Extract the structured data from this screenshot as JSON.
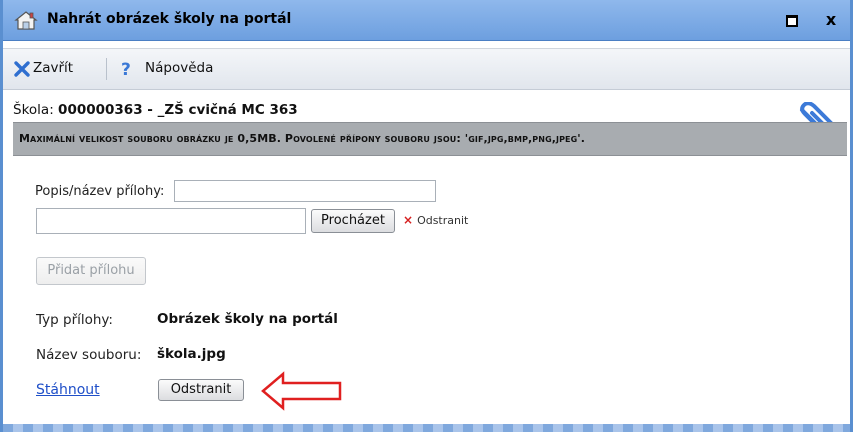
{
  "window": {
    "title": "Nahrát obrázek školy na portál",
    "close_glyph": "x",
    "icons": [
      "home-icon",
      "maximize-icon",
      "close-icon"
    ]
  },
  "toolbar": {
    "close_label": "Zavřít",
    "help_label": "Nápověda",
    "icons": [
      "close-x-icon",
      "help-question-icon"
    ]
  },
  "school": {
    "label": "Škola:",
    "value": "000000363 - _ZŠ cvičná MC 363"
  },
  "info_bar": {
    "text": "Maximální velikost souboru obrázku je 0,5MB. Povolené přípony souboru jsou: 'gif,jpg,bmp,png,jpeg'."
  },
  "form": {
    "description_label": "Popis/název přílohy:",
    "description_value": "",
    "file_value": "",
    "browse_label": "Procházet",
    "remove_link_label": "Odstranit",
    "add_attachment_label": "Přidat přílohu"
  },
  "attachment": {
    "type_label": "Typ přílohy:",
    "type_value": "Obrázek školy na portál",
    "filename_label": "Název souboru:",
    "filename_value": "škola.jpg",
    "download_label": "Stáhnout",
    "remove_button_label": "Odstranit"
  },
  "colors": {
    "titlebar": "#7ba9e4",
    "info_bar": "#a8acb0",
    "link": "#1f4fc8",
    "arrow": "#e02020"
  }
}
